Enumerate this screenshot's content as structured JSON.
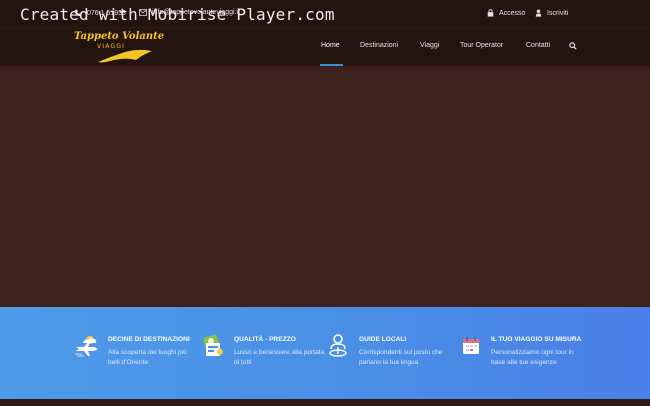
{
  "watermark": "Created with Mobirise Player.com",
  "topbar": {
    "phone": "076 1 51933",
    "email": "info@tappetovolanteviaggi.it",
    "login": "Accesso",
    "register": "Iscriviti"
  },
  "logo": {
    "title": "Tappeto Volante",
    "subtitle": "VIAGGI"
  },
  "nav": {
    "items": [
      {
        "label": "Home",
        "active": true
      },
      {
        "label": "Destinazioni"
      },
      {
        "label": "Viaggi"
      },
      {
        "label": "Tour Operator"
      },
      {
        "label": "Contatti"
      }
    ]
  },
  "features": [
    {
      "title": "DECINE DI DESTINAZIONI",
      "desc": "Alla scoperta dei luoghi più belli d'Oriente",
      "icon": "plane-cloud-icon"
    },
    {
      "title": "QUALITÀ - PREZZO",
      "desc": "Lusso e benessere alla portata di tutti",
      "icon": "money-quality-icon"
    },
    {
      "title": "GUIDE LOCALI",
      "desc": "Corrispondenti sul posto che parlano la tua lingua",
      "icon": "local-guide-icon"
    },
    {
      "title": "IL TUO VIAGGIO SU MISURA",
      "desc": "Personalizziamo ogni tour in base alle tue esigenze",
      "icon": "calendar-icon"
    }
  ],
  "colors": {
    "topbar_bg": "#24140f",
    "hero_bg": "#3c211c",
    "logo_gold": "#f2c623",
    "accent_blue": "#3e8bd6",
    "features_bg": "#4a8ee7"
  }
}
